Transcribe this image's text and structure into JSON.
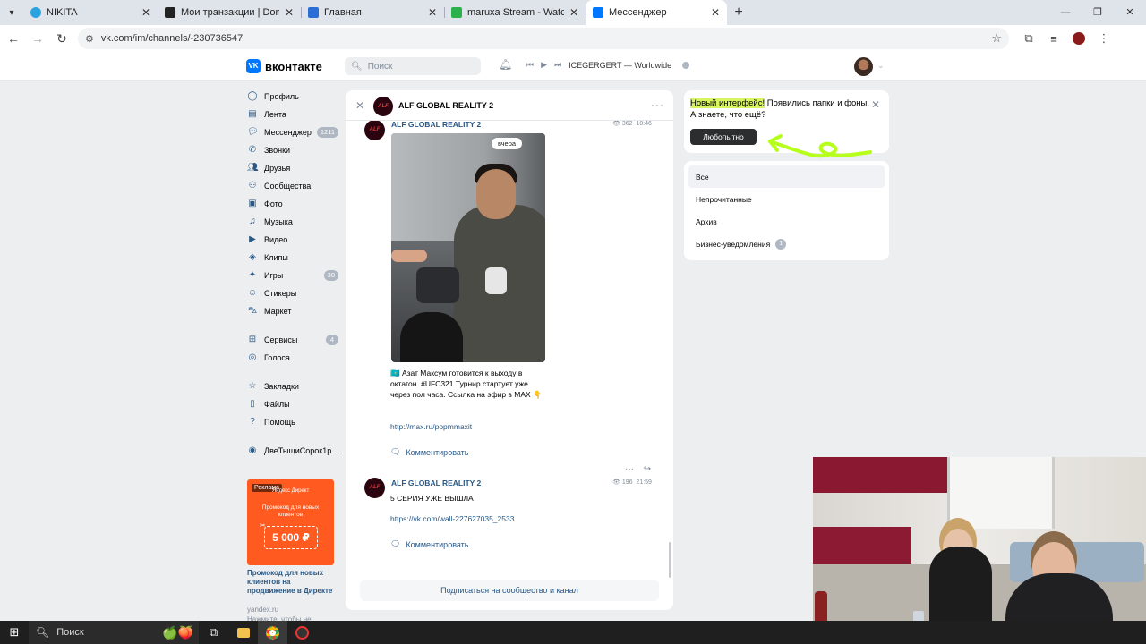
{
  "browser": {
    "tabs": [
      {
        "title": "NIKITA",
        "favicon_color": "#2aa3e0",
        "active": false
      },
      {
        "title": "Мои транзакции | DonatePay",
        "favicon_color": "#222222",
        "active": false
      },
      {
        "title": "Главная",
        "favicon_color": "#2b6fd6",
        "active": false
      },
      {
        "title": "maruxa Stream - Watch Live on",
        "favicon_color": "#2bb14b",
        "active": false
      },
      {
        "title": "Мессенджер",
        "favicon_color": "#0077ff",
        "active": true
      }
    ],
    "url": "vk.com/im/channels/-230736547"
  },
  "vk_header": {
    "logo_text": "вконтакте",
    "search_placeholder": "Поиск",
    "track": "ICEGERGERT — Worldwide"
  },
  "left_nav": [
    {
      "label": "Профиль",
      "icon": "profile-icon",
      "badge": ""
    },
    {
      "label": "Лента",
      "icon": "feed-icon",
      "badge": ""
    },
    {
      "label": "Мессенджер",
      "icon": "messenger-icon",
      "badge": "1211"
    },
    {
      "label": "Звонки",
      "icon": "phone-icon",
      "badge": ""
    },
    {
      "label": "Друзья",
      "icon": "friends-icon",
      "badge": ""
    },
    {
      "label": "Сообщества",
      "icon": "communities-icon",
      "badge": ""
    },
    {
      "label": "Фото",
      "icon": "photo-icon",
      "badge": ""
    },
    {
      "label": "Музыка",
      "icon": "music-icon",
      "badge": ""
    },
    {
      "label": "Видео",
      "icon": "video-icon",
      "badge": ""
    },
    {
      "label": "Клипы",
      "icon": "clips-icon",
      "badge": ""
    },
    {
      "label": "Игры",
      "icon": "games-icon",
      "badge": "30"
    },
    {
      "label": "Стикеры",
      "icon": "stickers-icon",
      "badge": ""
    },
    {
      "label": "Маркет",
      "icon": "market-icon",
      "badge": ""
    },
    {
      "label": "Сервисы",
      "icon": "services-icon",
      "badge": "4"
    },
    {
      "label": "Голоса",
      "icon": "votes-icon",
      "badge": ""
    },
    {
      "label": "Закладки",
      "icon": "bookmarks-icon",
      "badge": ""
    },
    {
      "label": "Файлы",
      "icon": "files-icon",
      "badge": ""
    },
    {
      "label": "Помощь",
      "icon": "help-icon",
      "badge": ""
    },
    {
      "label": "ДвеТыщиСорок1р...",
      "icon": "app-icon",
      "badge": ""
    }
  ],
  "ad": {
    "tag": "Реклама",
    "brand": "Яндекс Директ",
    "promo": "Промокод для новых клиентов",
    "amount": "5 000 ₽",
    "title": "Промокод для новых клиентов на продвижение в Директе",
    "domain": "yandex.ru",
    "more": "Нажмите, чтобы не"
  },
  "channel": {
    "name": "ALF GLOBAL REALITY 2",
    "avatar_text": "ALF",
    "post1": {
      "author": "ALF GLOBAL REALITY 2",
      "views": "362",
      "time": "18:46",
      "image_badge": "вчера",
      "text": "🇰🇿 Азат Максум готовится к выходу в октагон. #UFC321 Турнир стартует уже через пол часа. Ссылка на эфир в MAX 👇",
      "link": "http://max.ru/popmmaxit",
      "comment": "Комментировать"
    },
    "post2": {
      "author": "ALF GLOBAL REALITY 2",
      "views": "196",
      "time": "21:59",
      "text": "5 СЕРИЯ УЖЕ ВЫШЛА",
      "link": "https://vk.com/wall-227627035_2533",
      "comment": "Комментировать"
    },
    "subscribe": "Подписаться на сообщество и канал"
  },
  "promo_card": {
    "highlight": "Новый интерфейс!",
    "text": " Появились папки и фоны. А знаете, что ещё?",
    "button": "Любопытно"
  },
  "folders": [
    {
      "label": "Все",
      "badge": "",
      "active": true
    },
    {
      "label": "Непрочитанные",
      "badge": "",
      "active": false
    },
    {
      "label": "Архив",
      "badge": "",
      "active": false
    },
    {
      "label": "Бизнес-уведомления",
      "badge": "1",
      "active": false
    }
  ],
  "taskbar": {
    "search_label": "Поиск"
  }
}
